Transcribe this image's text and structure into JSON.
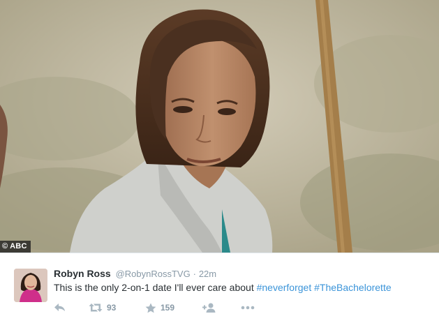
{
  "media": {
    "credit": "© ABC",
    "colors": {
      "sky": "#c6bfaa",
      "hair": "#4a3020",
      "skin": "#b98464",
      "shirt": "#cfd0cc",
      "post": "#a47e4a"
    }
  },
  "tweet": {
    "fullname": "Robyn Ross",
    "username": "@RobynRossTVG",
    "separator": "·",
    "time": "22m",
    "text_plain": "This is the only 2-on-1 date I'll ever care about ",
    "hashtag_1": "#neverforget",
    "hashtag_2": "#TheBachelorette",
    "colors": {
      "link": "#3b94d9",
      "meta": "#8899a6",
      "icon": "#aab8c2"
    }
  },
  "actions": {
    "reply_icon": "reply-icon",
    "retweet_icon": "retweet-icon",
    "retweet_count": "93",
    "favorite_icon": "star-icon",
    "favorite_count": "159",
    "follow_icon": "follow-user-icon",
    "more_icon": "more-dots-icon"
  }
}
